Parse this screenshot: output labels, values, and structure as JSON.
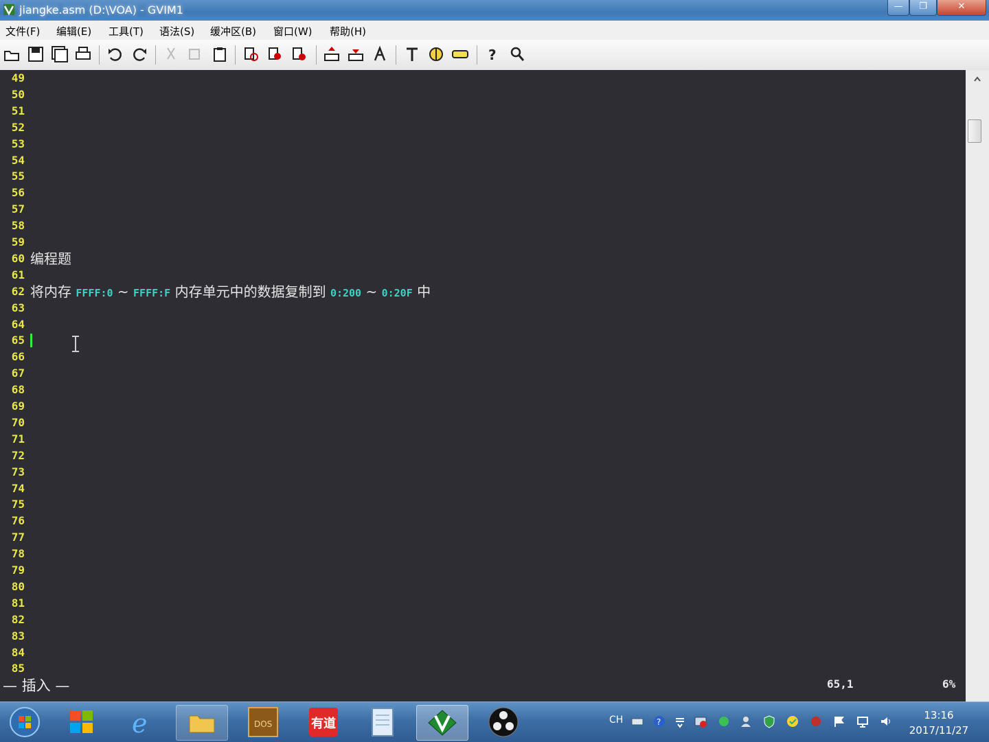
{
  "window": {
    "title": "jiangke.asm (D:\\VOA) - GVIM1",
    "minimize": "—",
    "maximize": "❐",
    "close": "✕"
  },
  "menu": [
    "文件(F)",
    "编辑(E)",
    "工具(T)",
    "语法(S)",
    "缓冲区(B)",
    "窗口(W)",
    "帮助(H)"
  ],
  "toolbar_icons": [
    "open-icon",
    "save-icon",
    "save-all-icon",
    "print-icon",
    "undo-icon",
    "redo-icon",
    "cut-icon",
    "copy-icon",
    "paste-icon",
    "find-replace-icon",
    "find-next-icon",
    "find-prev-icon",
    "load-session-icon",
    "save-session-icon",
    "run-script-icon",
    "make-icon",
    "build-tags-icon",
    "jump-tag-icon",
    "help-icon",
    "find-help-icon"
  ],
  "editor": {
    "lines": [
      {
        "n": "49",
        "text": ""
      },
      {
        "n": "50",
        "text": ""
      },
      {
        "n": "51",
        "text": ""
      },
      {
        "n": "52",
        "text": ""
      },
      {
        "n": "53",
        "text": ""
      },
      {
        "n": "54",
        "text": ""
      },
      {
        "n": "55",
        "text": ""
      },
      {
        "n": "56",
        "text": ""
      },
      {
        "n": "57",
        "text": ""
      },
      {
        "n": "58",
        "text": ""
      },
      {
        "n": "59",
        "text": ""
      },
      {
        "n": "60",
        "text": "编程题"
      },
      {
        "n": "61",
        "text": ""
      },
      {
        "n": "62",
        "segments": [
          {
            "t": "将内存 ",
            "kind": "text"
          },
          {
            "t": "FFFF:0",
            "kind": "num"
          },
          {
            "t": " ~ ",
            "kind": "text"
          },
          {
            "t": "FFFF:F",
            "kind": "num"
          },
          {
            "t": " 内存单元中的数据复制到 ",
            "kind": "text"
          },
          {
            "t": "0:200",
            "kind": "num"
          },
          {
            "t": " ~ ",
            "kind": "text"
          },
          {
            "t": "0:20F",
            "kind": "num"
          },
          {
            "t": " 中",
            "kind": "text"
          }
        ]
      },
      {
        "n": "63",
        "text": ""
      },
      {
        "n": "64",
        "text": ""
      },
      {
        "n": "65",
        "text": "",
        "cursor": true
      },
      {
        "n": "66",
        "text": ""
      },
      {
        "n": "67",
        "text": ""
      },
      {
        "n": "68",
        "text": ""
      },
      {
        "n": "69",
        "text": ""
      },
      {
        "n": "70",
        "text": ""
      },
      {
        "n": "71",
        "text": ""
      },
      {
        "n": "72",
        "text": ""
      },
      {
        "n": "73",
        "text": ""
      },
      {
        "n": "74",
        "text": ""
      },
      {
        "n": "75",
        "text": ""
      },
      {
        "n": "76",
        "text": ""
      },
      {
        "n": "77",
        "text": ""
      },
      {
        "n": "78",
        "text": ""
      },
      {
        "n": "79",
        "text": ""
      },
      {
        "n": "80",
        "text": ""
      },
      {
        "n": "81",
        "text": ""
      },
      {
        "n": "82",
        "text": ""
      },
      {
        "n": "83",
        "text": ""
      },
      {
        "n": "84",
        "text": ""
      },
      {
        "n": "85",
        "text": ""
      }
    ]
  },
  "status": {
    "mode": "— 插入 —",
    "position": "65,1",
    "percent": "6%"
  },
  "colors": {
    "background": "#2e2d33",
    "line_number": "#e8e84a",
    "number_literal": "#3ad3c5",
    "text": "#e6e6e6",
    "cursor": "#37e84b"
  },
  "taskbar": {
    "apps": [
      "start-orb-icon",
      "windows-flag-icon",
      "internet-explorer-icon",
      "file-explorer-icon",
      "dosbox-icon",
      "youdao-dict-icon",
      "notepad-icon",
      "gvim-icon",
      "obs-icon"
    ],
    "tray": {
      "lang": "CH"
    },
    "clock": {
      "time": "13:16",
      "date": "2017/11/27"
    }
  }
}
